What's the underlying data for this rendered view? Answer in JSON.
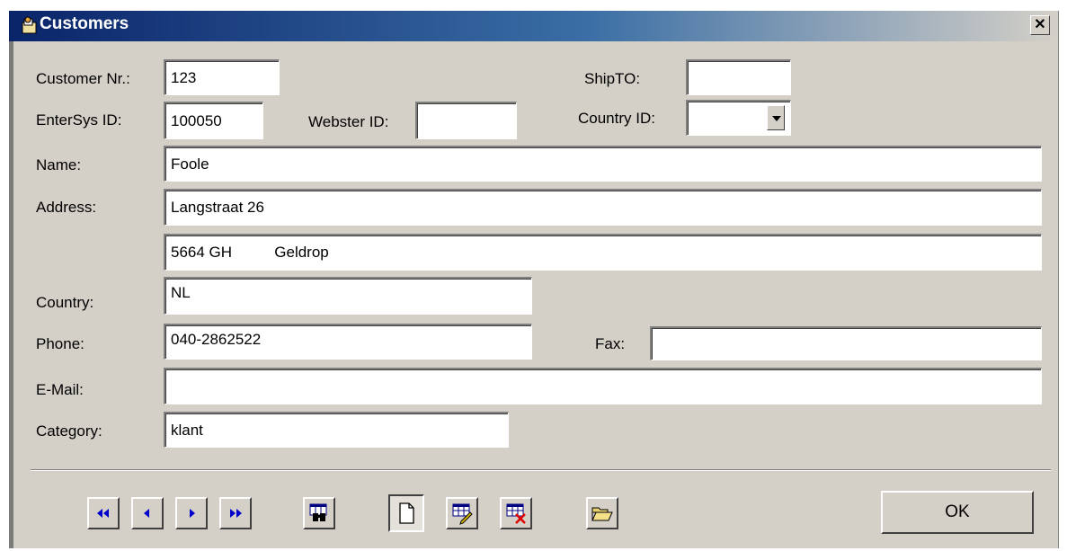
{
  "window": {
    "title": "Customers",
    "close_glyph": "✕"
  },
  "labels": {
    "customer_nr": "Customer Nr.:",
    "entersys_id": "EnterSys ID:",
    "webster_id": "Webster ID:",
    "shipto": "ShipTO:",
    "country_id": "Country ID:",
    "name": "Name:",
    "address": "Address:",
    "country": "Country:",
    "phone": "Phone:",
    "fax": "Fax:",
    "email": "E-Mail:",
    "category": "Category:"
  },
  "fields": {
    "customer_nr": "123",
    "entersys_id": "100050",
    "webster_id": "",
    "shipto": "",
    "country_id": "",
    "name": "Foole",
    "address1": "Langstraat 26",
    "address2": "5664 GH          Geldrop",
    "country": "NL",
    "phone": "040-2862522",
    "fax": "",
    "email": "",
    "category": "klant"
  },
  "buttons": {
    "ok": "OK"
  },
  "icons": {
    "first": "first-record-icon",
    "prev": "previous-record-icon",
    "next": "next-record-icon",
    "last": "last-record-icon",
    "find": "find-binoculars-icon",
    "new": "new-document-icon",
    "edit": "edit-record-icon",
    "delete": "delete-record-icon",
    "open": "open-folder-icon"
  },
  "colors": {
    "titlebar_start": "#0a246a",
    "face": "#d4d0c8",
    "nav_arrow": "#0000cc",
    "delete_x": "#e00000"
  }
}
